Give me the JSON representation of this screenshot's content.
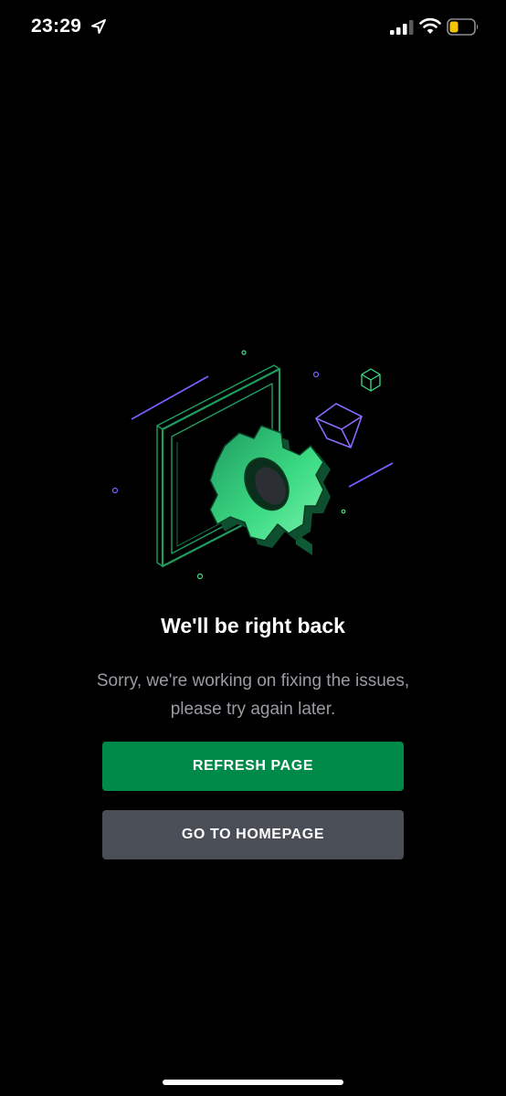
{
  "status_bar": {
    "time": "23:29",
    "icons": [
      "location-arrow-icon",
      "cellular-signal-icon",
      "wifi-icon",
      "battery-icon"
    ],
    "battery_color": "#f5c400"
  },
  "illustration": {
    "icon": "maintenance-gear-illustration",
    "colors": {
      "gear": "#3ddc84",
      "frame": "#1f9d5f",
      "accent_lines": "#7b5cff"
    }
  },
  "content": {
    "title": "We'll be right back",
    "message": "Sorry, we're working on fixing the issues, please try again later."
  },
  "buttons": {
    "refresh_label": "REFRESH PAGE",
    "home_label": "GO TO HOMEPAGE"
  },
  "colors": {
    "background": "#000000",
    "primary_button": "#008a4a",
    "secondary_button": "#4a4e57",
    "message_text": "#9a9ca3"
  }
}
